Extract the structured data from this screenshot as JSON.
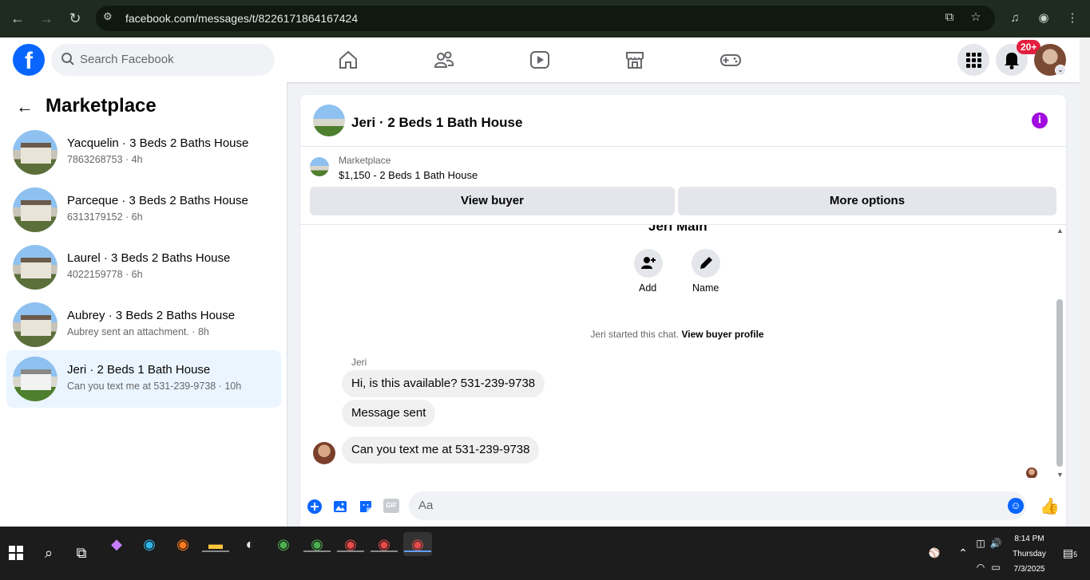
{
  "browser": {
    "url": "facebook.com/messages/t/8226171864167424"
  },
  "header": {
    "search_placeholder": "Search Facebook",
    "notification_badge": "20+"
  },
  "sidebar": {
    "title": "Marketplace",
    "conversations": [
      {
        "name": "Yacquelin · 3 Beds 2 Baths House",
        "sub": "7863268753 · 4h",
        "active": false
      },
      {
        "name": "Parceque · 3 Beds 2 Baths House",
        "sub": "6313179152 · 6h",
        "active": false
      },
      {
        "name": "Laurel · 3 Beds 2 Baths House",
        "sub": "4022159778 · 6h",
        "active": false
      },
      {
        "name": "Aubrey · 3 Beds 2 Baths House",
        "sub": "Aubrey sent an attachment. · 8h",
        "active": false
      },
      {
        "name": "Jeri · 2 Beds 1 Bath House",
        "sub": "Can you text me at 531-239-9738 · 10h",
        "active": true
      }
    ]
  },
  "chat": {
    "title": "Jeri · 2 Beds 1 Bath House",
    "marketplace_label": "Marketplace",
    "listing": "$1,150 - 2 Beds 1 Bath House",
    "view_buyer": "View buyer",
    "more_options": "More options",
    "contact_name": "Jeri Main",
    "add_label": "Add",
    "name_label": "Name",
    "started_text": "Jeri started this chat.",
    "view_profile": "View buyer profile",
    "sender": "Jeri",
    "messages": [
      "Hi, is this available? 531-239-9738",
      "Message sent",
      "Can you text me at 531-239-9738"
    ],
    "composer_placeholder": "Aa",
    "gif_label": "GIF"
  },
  "taskbar": {
    "time": "8:14 PM",
    "day": "Thursday",
    "date": "7/3/2025",
    "notif_count": "5"
  }
}
